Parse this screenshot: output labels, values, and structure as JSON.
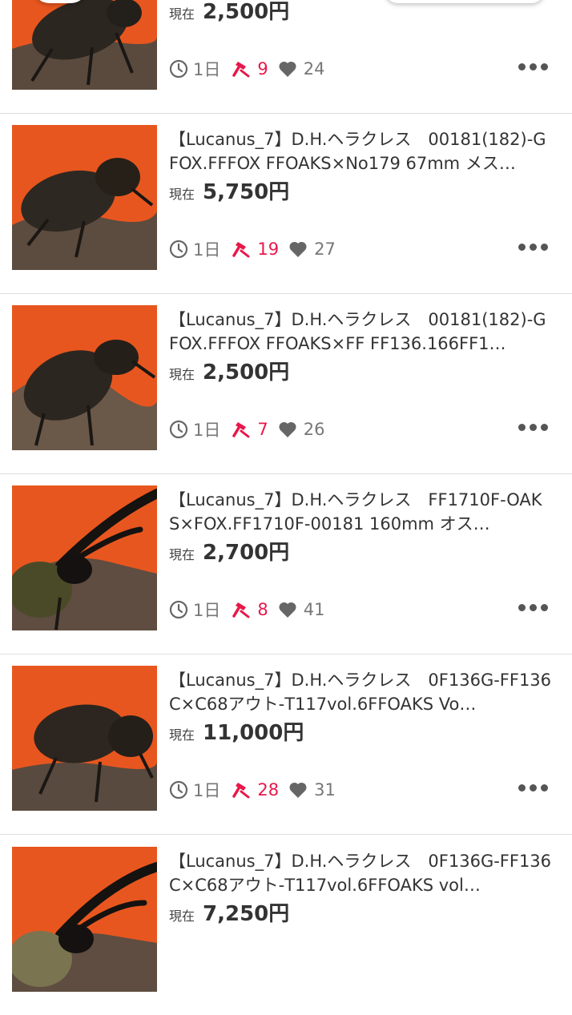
{
  "listing": {
    "price_label": "現在",
    "time_icon": "clock-icon",
    "bid_icon": "gavel-icon",
    "watch_icon": "heart-icon",
    "more_icon": "more-dots-icon",
    "bid_color": "#e8184a",
    "thumb_bg": "#e8561f",
    "items": [
      {
        "title": "",
        "price": "2,500円",
        "time": "1日",
        "bids": "9",
        "watchers": "24"
      },
      {
        "title": "【Lucanus_7】D.H.ヘラクレス　00181(182)-GFOX.FFFOX FFOAKS×No179 67mm メス…",
        "price": "5,750円",
        "time": "1日",
        "bids": "19",
        "watchers": "27"
      },
      {
        "title": "【Lucanus_7】D.H.ヘラクレス　00181(182)-GFOX.FFFOX FFOAKS×FF FF136.166FF1…",
        "price": "2,500円",
        "time": "1日",
        "bids": "7",
        "watchers": "26"
      },
      {
        "title": "【Lucanus_7】D.H.ヘラクレス　FF1710F-OAKS×FOX.FF1710F-00181 160mm オス…",
        "price": "2,700円",
        "time": "1日",
        "bids": "8",
        "watchers": "41"
      },
      {
        "title": "【Lucanus_7】D.H.ヘラクレス　0F136G-FF136C×C68アウト-T117vol.6FFOAKS Vo…",
        "price": "11,000円",
        "time": "1日",
        "bids": "28",
        "watchers": "31"
      },
      {
        "title": "【Lucanus_7】D.H.ヘラクレス　0F136G-FF136C×C68アウト-T117vol.6FFOAKS vol…",
        "price": "7,250円",
        "time": "",
        "bids": "",
        "watchers": ""
      }
    ]
  }
}
